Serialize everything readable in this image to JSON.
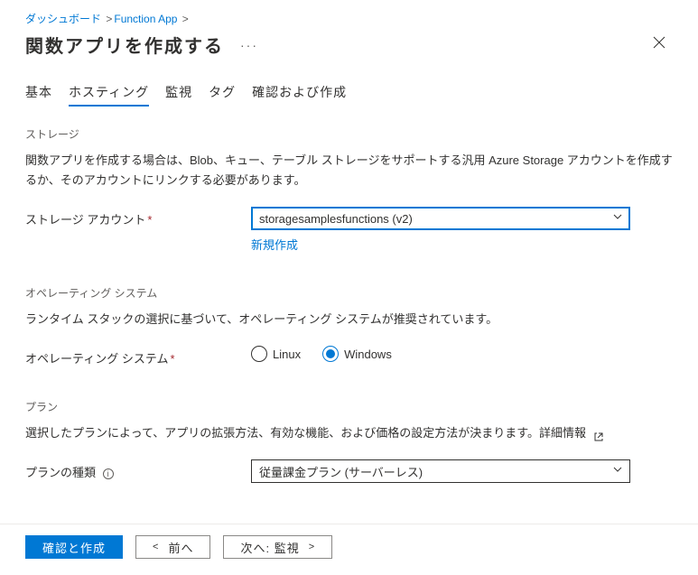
{
  "breadcrumb": {
    "dashboard": "ダッシュボード",
    "function_app": "Function App"
  },
  "title": "関数アプリを作成する",
  "tabs": {
    "basics": "基本",
    "hosting": "ホスティング",
    "monitoring": "監視",
    "tags": "タグ",
    "review": "確認および作成"
  },
  "storage": {
    "heading": "ストレージ",
    "description": "関数アプリを作成する場合は、Blob、キュー、テーブル ストレージをサポートする汎用 Azure Storage アカウントを作成するか、そのアカウントにリンクする必要があります。",
    "account_label": "ストレージ アカウント",
    "account_value": "storagesamplesfunctions (v2)",
    "create_new": "新規作成"
  },
  "os": {
    "heading": "オペレーティング システム",
    "description": "ランタイム スタックの選択に基づいて、オペレーティング システムが推奨されています。",
    "label": "オペレーティング システム",
    "linux": "Linux",
    "windows": "Windows",
    "selected": "windows"
  },
  "plan": {
    "heading": "プラン",
    "description": "選択したプランによって、アプリの拡張方法、有効な機能、および価格の設定方法が決まります。詳細情報",
    "type_label": "プランの種類",
    "type_value": "従量課金プラン (サーバーレス)"
  },
  "footer": {
    "review_create": "確認と作成",
    "previous": "前へ",
    "next": "次へ: 監視"
  }
}
